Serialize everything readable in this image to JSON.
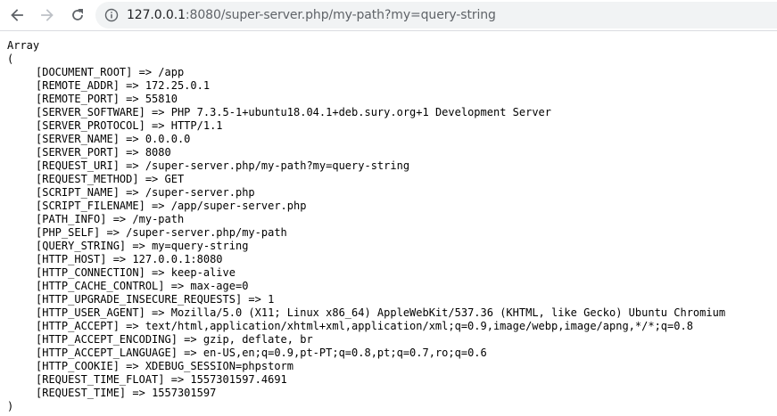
{
  "browser": {
    "url_host": "127.0.0.1",
    "url_rest": ":8080/super-server.php/my-path?my=query-string"
  },
  "output": {
    "header": "Array",
    "open": "(",
    "close": ")",
    "entries": [
      {
        "key": "[DOCUMENT_ROOT]",
        "value": "/app"
      },
      {
        "key": "[REMOTE_ADDR]",
        "value": "172.25.0.1"
      },
      {
        "key": "[REMOTE_PORT]",
        "value": "55810"
      },
      {
        "key": "[SERVER_SOFTWARE]",
        "value": "PHP 7.3.5-1+ubuntu18.04.1+deb.sury.org+1 Development Server"
      },
      {
        "key": "[SERVER_PROTOCOL]",
        "value": "HTTP/1.1"
      },
      {
        "key": "[SERVER_NAME]",
        "value": "0.0.0.0"
      },
      {
        "key": "[SERVER_PORT]",
        "value": "8080"
      },
      {
        "key": "[REQUEST_URI]",
        "value": "/super-server.php/my-path?my=query-string"
      },
      {
        "key": "[REQUEST_METHOD]",
        "value": "GET"
      },
      {
        "key": "[SCRIPT_NAME]",
        "value": "/super-server.php"
      },
      {
        "key": "[SCRIPT_FILENAME]",
        "value": "/app/super-server.php"
      },
      {
        "key": "[PATH_INFO]",
        "value": "/my-path"
      },
      {
        "key": "[PHP_SELF]",
        "value": "/super-server.php/my-path"
      },
      {
        "key": "[QUERY_STRING]",
        "value": "my=query-string"
      },
      {
        "key": "[HTTP_HOST]",
        "value": "127.0.0.1:8080"
      },
      {
        "key": "[HTTP_CONNECTION]",
        "value": "keep-alive"
      },
      {
        "key": "[HTTP_CACHE_CONTROL]",
        "value": "max-age=0"
      },
      {
        "key": "[HTTP_UPGRADE_INSECURE_REQUESTS]",
        "value": "1"
      },
      {
        "key": "[HTTP_USER_AGENT]",
        "value": "Mozilla/5.0 (X11; Linux x86_64) AppleWebKit/537.36 (KHTML, like Gecko) Ubuntu Chromium"
      },
      {
        "key": "[HTTP_ACCEPT]",
        "value": "text/html,application/xhtml+xml,application/xml;q=0.9,image/webp,image/apng,*/*;q=0.8"
      },
      {
        "key": "[HTTP_ACCEPT_ENCODING]",
        "value": "gzip, deflate, br"
      },
      {
        "key": "[HTTP_ACCEPT_LANGUAGE]",
        "value": "en-US,en;q=0.9,pt-PT;q=0.8,pt;q=0.7,ro;q=0.6"
      },
      {
        "key": "[HTTP_COOKIE]",
        "value": "XDEBUG_SESSION=phpstorm"
      },
      {
        "key": "[REQUEST_TIME_FLOAT]",
        "value": "1557301597.4691"
      },
      {
        "key": "[REQUEST_TIME]",
        "value": "1557301597"
      }
    ]
  }
}
